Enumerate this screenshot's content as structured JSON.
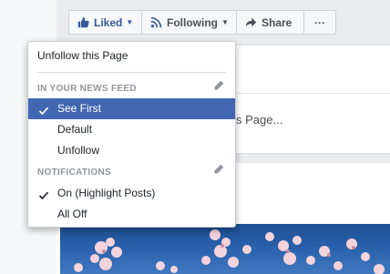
{
  "action_bar": {
    "liked_label": "Liked",
    "following_label": "Following",
    "share_label": "Share",
    "more_label": "···"
  },
  "background": {
    "partial_text": "s Page..."
  },
  "menu": {
    "unfollow_page": "Unfollow this Page",
    "news_feed_heading": "IN YOUR NEWS FEED",
    "see_first": "See First",
    "default": "Default",
    "unfollow": "Unfollow",
    "notifications_heading": "NOTIFICATIONS",
    "on_highlight": "On (Highlight Posts)",
    "all_off": "All Off"
  },
  "colors": {
    "brand_blue": "#4267b2",
    "liked_blue": "#365899"
  },
  "icons": {
    "liked": "thumbs-up-icon",
    "following": "rss-feed-icon",
    "share": "share-arrow-icon",
    "edit": "pencil-icon",
    "selected": "check-icon"
  }
}
